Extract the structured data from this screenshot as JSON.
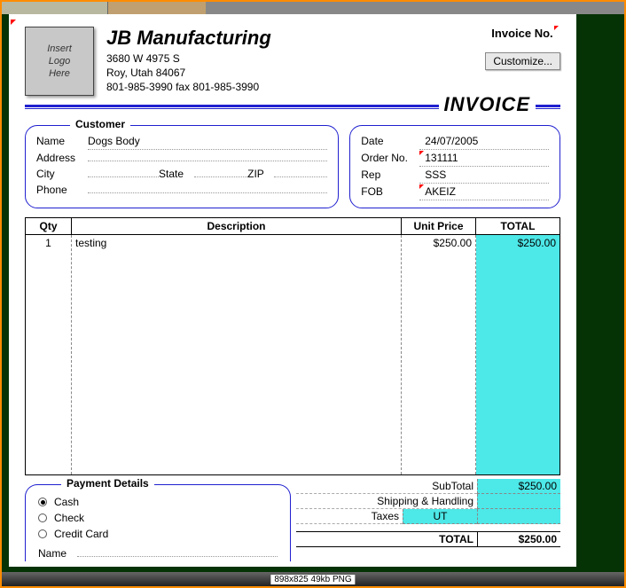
{
  "logo_placeholder": "Insert\nLogo\nHere",
  "company": {
    "name": "JB Manufacturing",
    "street": "3680 W 4975 S",
    "city_line": "Roy, Utah  84067",
    "phone_line": "801-985-3990 fax 801-985-3990"
  },
  "invoice_no_label": "Invoice No.",
  "customize_label": "Customize...",
  "invoice_title": "INVOICE",
  "customer": {
    "title": "Customer",
    "name_label": "Name",
    "name_value": "Dogs Body",
    "address_label": "Address",
    "city_label": "City",
    "state_label": "State",
    "zip_label": "ZIP",
    "phone_label": "Phone"
  },
  "order": {
    "date_label": "Date",
    "date_value": "24/07/2005",
    "orderno_label": "Order No.",
    "orderno_value": "131111",
    "rep_label": "Rep",
    "rep_value": "SSS",
    "fob_label": "FOB",
    "fob_value": "AKEIZ"
  },
  "columns": {
    "qty": "Qty",
    "desc": "Description",
    "price": "Unit Price",
    "total": "TOTAL"
  },
  "line": {
    "qty": "1",
    "desc": "testing",
    "price": "$250.00",
    "total": "$250.00"
  },
  "totals": {
    "subtotal_label": "SubTotal",
    "subtotal_value": "$250.00",
    "shipping_label": "Shipping & Handling",
    "taxes_label": "Taxes",
    "taxes_mid": "UT",
    "total_label": "TOTAL",
    "total_value": "$250.00"
  },
  "payment": {
    "title": "Payment Details",
    "cash": "Cash",
    "check": "Check",
    "cc": "Credit Card",
    "name_label": "Name"
  },
  "meta": "898x825  49kb  PNG"
}
